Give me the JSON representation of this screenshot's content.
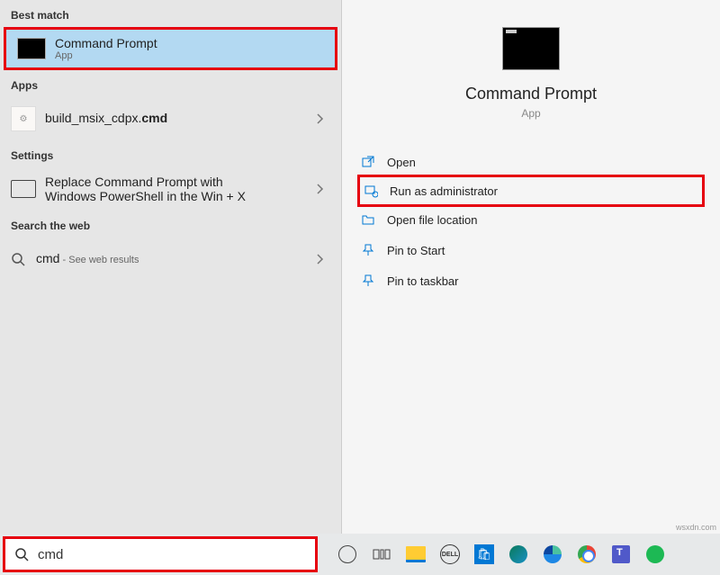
{
  "left": {
    "best_match_heading": "Best match",
    "best_match": {
      "title": "Command Prompt",
      "subtitle": "App"
    },
    "apps_heading": "Apps",
    "apps": [
      {
        "prefix": "build_msix_cdpx.",
        "bold": "cmd"
      }
    ],
    "settings_heading": "Settings",
    "settings": [
      {
        "line1": "Replace Command Prompt with",
        "line2": "Windows PowerShell in the Win + X"
      }
    ],
    "web_heading": "Search the web",
    "web": {
      "term": "cmd",
      "suffix": " - See web results"
    }
  },
  "right": {
    "title": "Command Prompt",
    "subtitle": "App",
    "actions": {
      "open": "Open",
      "run_admin": "Run as administrator",
      "open_loc": "Open file location",
      "pin_start": "Pin to Start",
      "pin_task": "Pin to taskbar"
    }
  },
  "taskbar": {
    "search_value": "cmd",
    "dell": "DELL"
  },
  "watermark": "wsxdn.com"
}
